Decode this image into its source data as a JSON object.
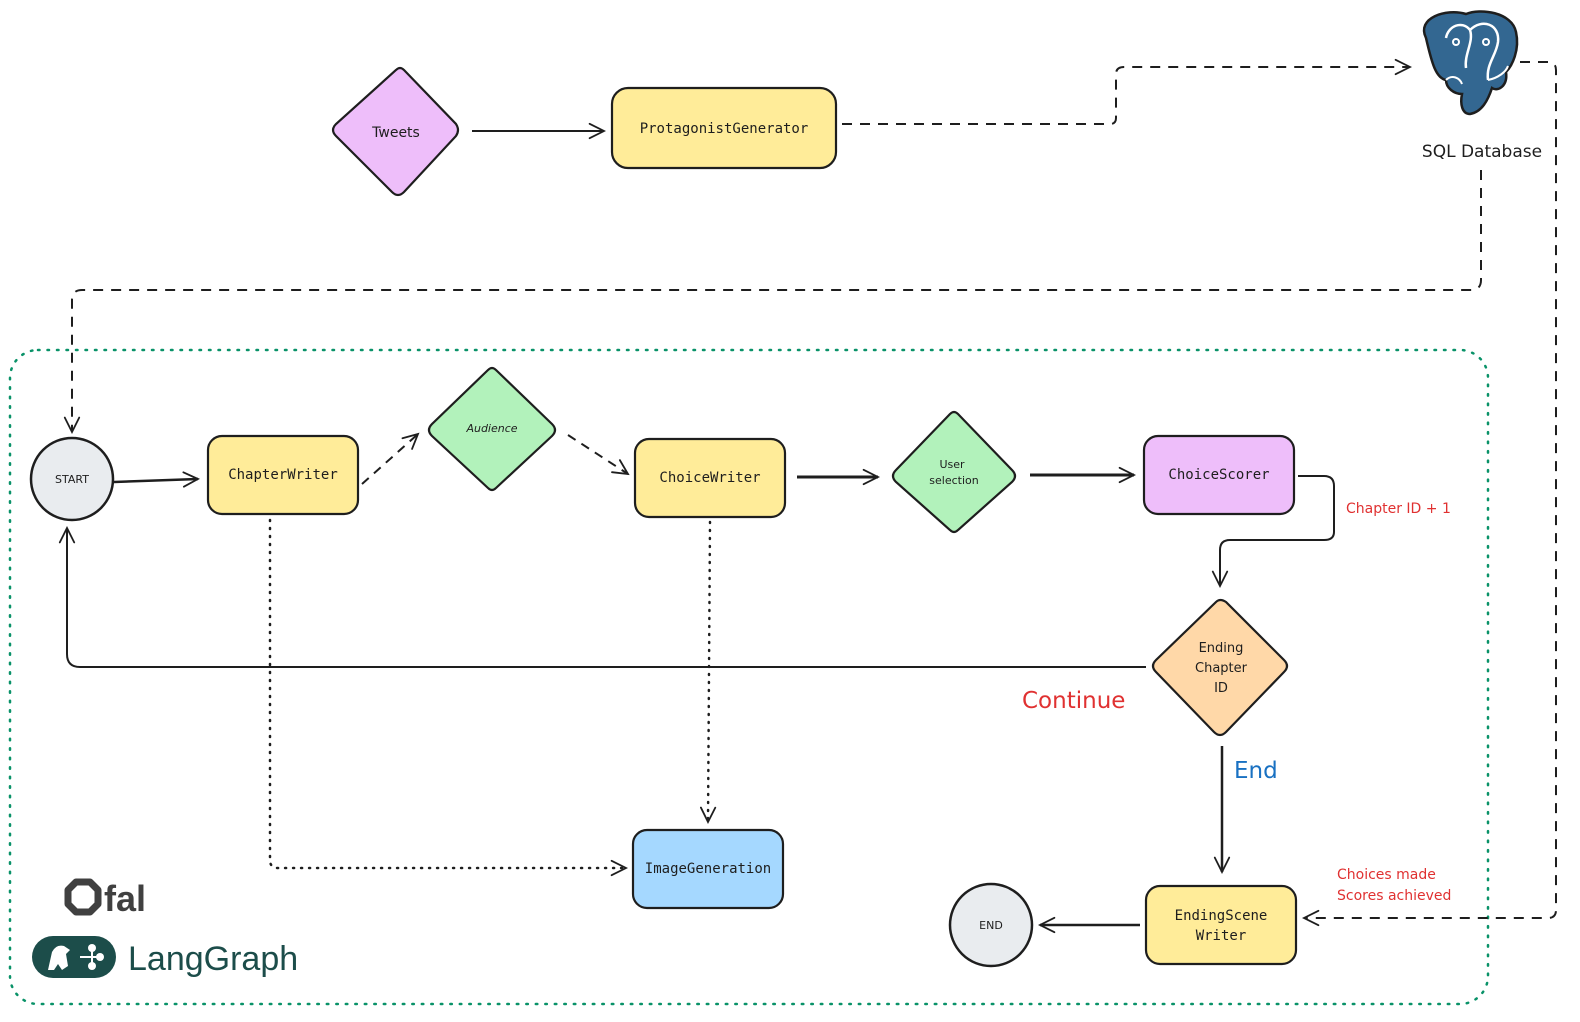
{
  "diagram": {
    "top_flow": {
      "tweets": "Tweets",
      "protagonist_generator": "ProtagonistGenerator",
      "database_label": "SQL Database"
    },
    "graph": {
      "start": "START",
      "chapter_writer": "ChapterWriter",
      "audience": "Audience",
      "choice_writer": "ChoiceWriter",
      "user_selection_line1": "User",
      "user_selection_line2": "selection",
      "choice_scorer": "ChoiceScorer",
      "chapter_id_note": "Chapter ID + 1",
      "ending_chapter_line1": "Ending",
      "ending_chapter_line2": "Chapter",
      "ending_chapter_line3": "ID",
      "continue_label": "Continue",
      "end_label": "End",
      "ending_scene_line1": "EndingScene",
      "ending_scene_line2": "Writer",
      "end": "END",
      "image_generation": "ImageGeneration",
      "choices_note_line1": "Choices made",
      "choices_note_line2": "Scores achieved"
    },
    "logos": {
      "fal": "fal",
      "langgraph": "LangGraph"
    },
    "colors": {
      "yellow": "#ffec99",
      "purple": "#eebefa",
      "green": "#b2f2bb",
      "orange": "#ffd8a8",
      "blue": "#a5d8ff",
      "gray": "#e9ecef",
      "postgres_blue": "#336791",
      "group_border": "#099268",
      "red_note": "#e03131",
      "blue_note": "#1971c2",
      "langgraph_green": "#1c4d4a",
      "fal_gray": "#404040"
    }
  }
}
